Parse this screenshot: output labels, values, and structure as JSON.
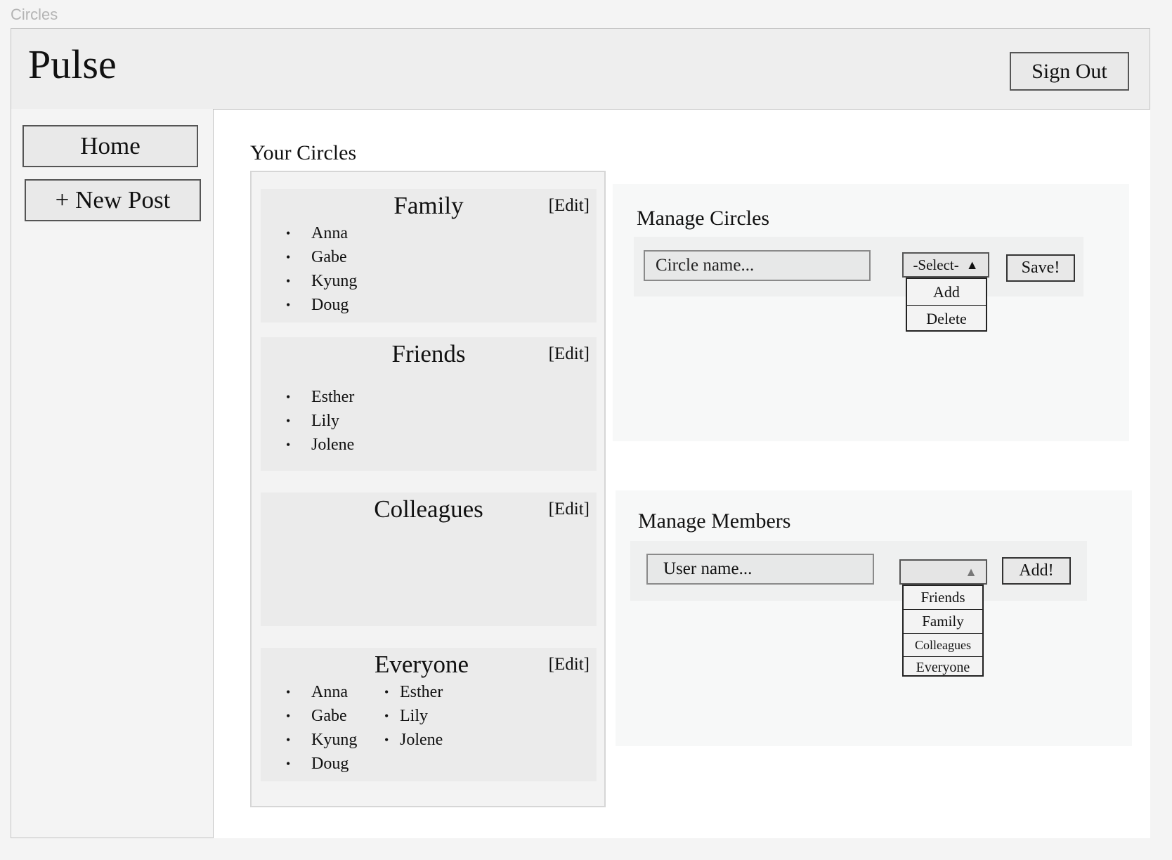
{
  "page": {
    "label": "Circles"
  },
  "header": {
    "logo": "Pulse",
    "sign_out": "Sign Out"
  },
  "sidebar": {
    "items": [
      {
        "label": "Home"
      },
      {
        "label": "+ New Post"
      }
    ]
  },
  "circles": {
    "title": "Your Circles",
    "edit_label": "[Edit]",
    "cards": [
      {
        "name": "Family",
        "members": [
          "Anna",
          "Gabe",
          "Kyung",
          "Doug"
        ],
        "members_col2": []
      },
      {
        "name": "Friends",
        "members": [
          "Esther",
          "Lily",
          "Jolene"
        ],
        "members_col2": []
      },
      {
        "name": "Colleagues",
        "members": [],
        "members_col2": []
      },
      {
        "name": "Everyone",
        "members": [
          "Anna",
          "Gabe",
          "Kyung",
          "Doug"
        ],
        "members_col2": [
          "Esther",
          "Lily",
          "Jolene"
        ]
      }
    ]
  },
  "manage_circles": {
    "title": "Manage Circles",
    "input_placeholder": "Circle name...",
    "select_value": "-Select-",
    "select_arrow": "▲",
    "options": [
      "Add",
      "Delete"
    ],
    "button": "Save!"
  },
  "manage_members": {
    "title": "Manage Members",
    "input_placeholder": "User name...",
    "select_value": "",
    "select_arrow": "▲",
    "options": [
      "Friends",
      "Family",
      "Colleagues",
      "Everyone"
    ],
    "button": "Add!"
  }
}
